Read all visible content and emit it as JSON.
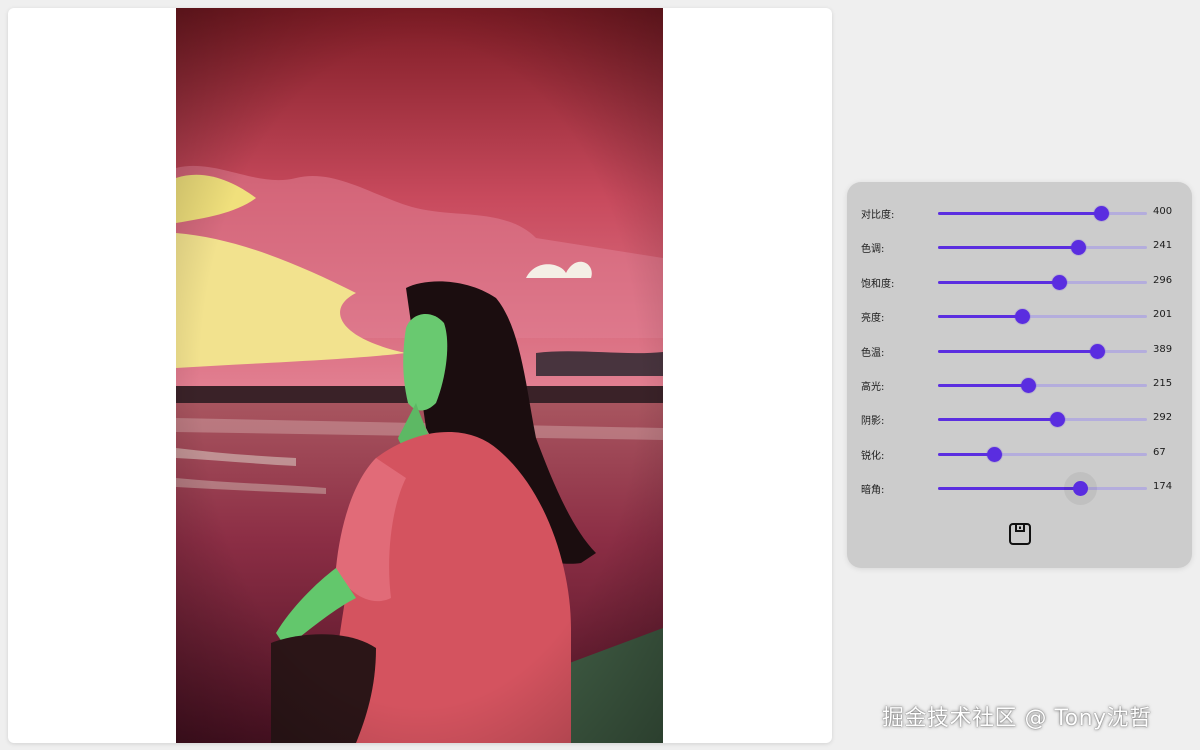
{
  "editor": {
    "sliders": [
      {
        "label": "对比度:",
        "value": "400",
        "fraction": 0.78
      },
      {
        "label": "色调:",
        "value": "241",
        "fraction": 0.67
      },
      {
        "label": "饱和度:",
        "value": "296",
        "fraction": 0.58
      },
      {
        "label": "亮度:",
        "value": "201",
        "fraction": 0.4
      },
      {
        "label": "色温:",
        "value": "389",
        "fraction": 0.76
      },
      {
        "label": "高光:",
        "value": "215",
        "fraction": 0.43
      },
      {
        "label": "阴影:",
        "value": "292",
        "fraction": 0.57
      },
      {
        "label": "锐化:",
        "value": "67",
        "fraction": 0.27
      },
      {
        "label": "暗角:",
        "value": "174",
        "fraction": 0.68
      }
    ],
    "accent_color": "#5b2ee0",
    "save_icon": "save-icon"
  },
  "watermark": "掘金技术社区 @ Tony沈哲"
}
